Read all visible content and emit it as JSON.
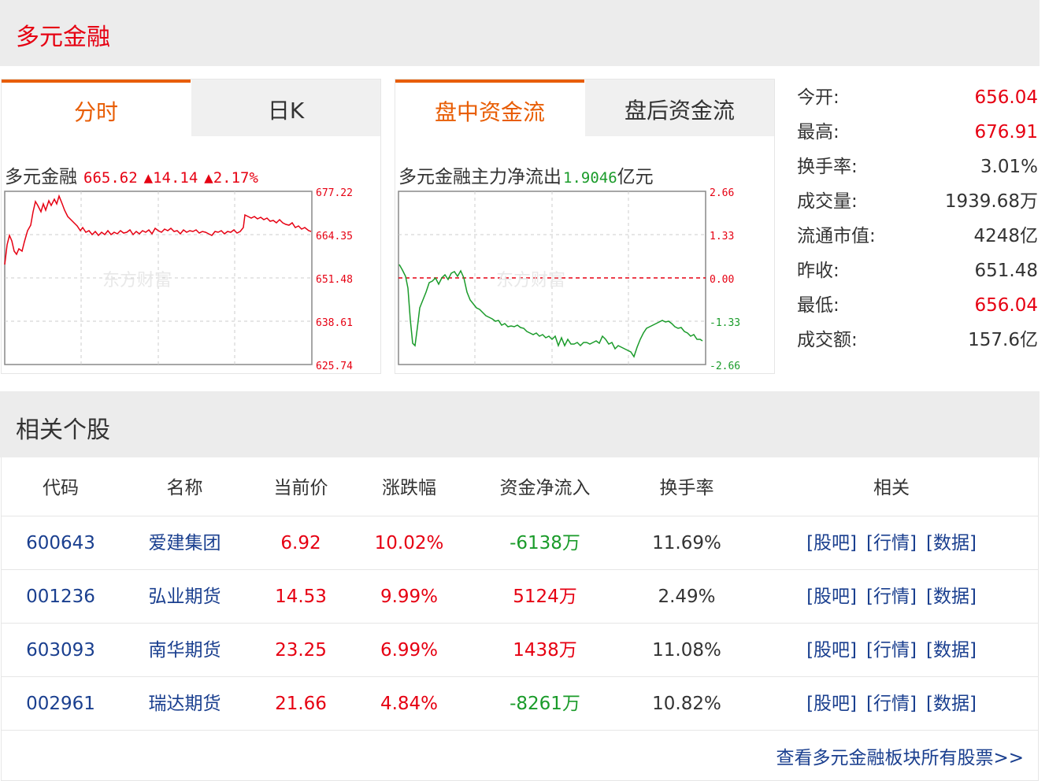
{
  "header": {
    "title": "多元金融"
  },
  "panel1": {
    "tabs": [
      "分时",
      "日K"
    ],
    "title": "多元金融",
    "price": "665.62",
    "change": "▲14.14",
    "pct": "▲2.17%",
    "y_labels": [
      "677.22",
      "664.35",
      "651.48",
      "638.61",
      "625.74"
    ],
    "watermark": "东方财富",
    "line_color": "#e60012"
  },
  "panel2": {
    "tabs": [
      "盘中资金流",
      "盘后资金流"
    ],
    "title": "多元金融主力净流出",
    "value": "1.9046",
    "unit": "亿元",
    "y_labels": [
      "2.66",
      "1.33",
      "0.00",
      "-1.33",
      "-2.66"
    ],
    "watermark": "东方财富",
    "line_color": "#1a9b2a"
  },
  "stats": [
    {
      "label": "今开:",
      "value": "656.04",
      "color": "red"
    },
    {
      "label": "最高:",
      "value": "676.91",
      "color": "red"
    },
    {
      "label": "换手率:",
      "value": "3.01%",
      "color": "dark"
    },
    {
      "label": "成交量:",
      "value": "1939.68万",
      "color": "dark"
    },
    {
      "label": "流通市值:",
      "value": "4248亿",
      "color": "dark"
    },
    {
      "label": "昨收:",
      "value": "651.48",
      "color": "dark"
    },
    {
      "label": "最低:",
      "value": "656.04",
      "color": "red"
    },
    {
      "label": "成交额:",
      "value": "157.6亿",
      "color": "dark"
    }
  ],
  "section": {
    "title": "相关个股"
  },
  "table": {
    "headers": [
      "代码",
      "名称",
      "当前价",
      "涨跌幅",
      "资金净流入",
      "换手率",
      "相关"
    ],
    "links": [
      "[股吧]",
      "[行情]",
      "[数据]"
    ],
    "rows": [
      {
        "code": "600643",
        "name": "爱建集团",
        "price": "6.92",
        "pct": "10.02%",
        "flow": "-6138万",
        "flow_dir": "down",
        "turnover": "11.69%"
      },
      {
        "code": "001236",
        "name": "弘业期货",
        "price": "14.53",
        "pct": "9.99%",
        "flow": "5124万",
        "flow_dir": "up",
        "turnover": "2.49%"
      },
      {
        "code": "603093",
        "name": "南华期货",
        "price": "23.25",
        "pct": "6.99%",
        "flow": "1438万",
        "flow_dir": "up",
        "turnover": "11.08%"
      },
      {
        "code": "002961",
        "name": "瑞达期货",
        "price": "21.66",
        "pct": "4.84%",
        "flow": "-8261万",
        "flow_dir": "down",
        "turnover": "10.82%"
      }
    ],
    "more": "查看多元金融板块所有股票>>"
  }
}
